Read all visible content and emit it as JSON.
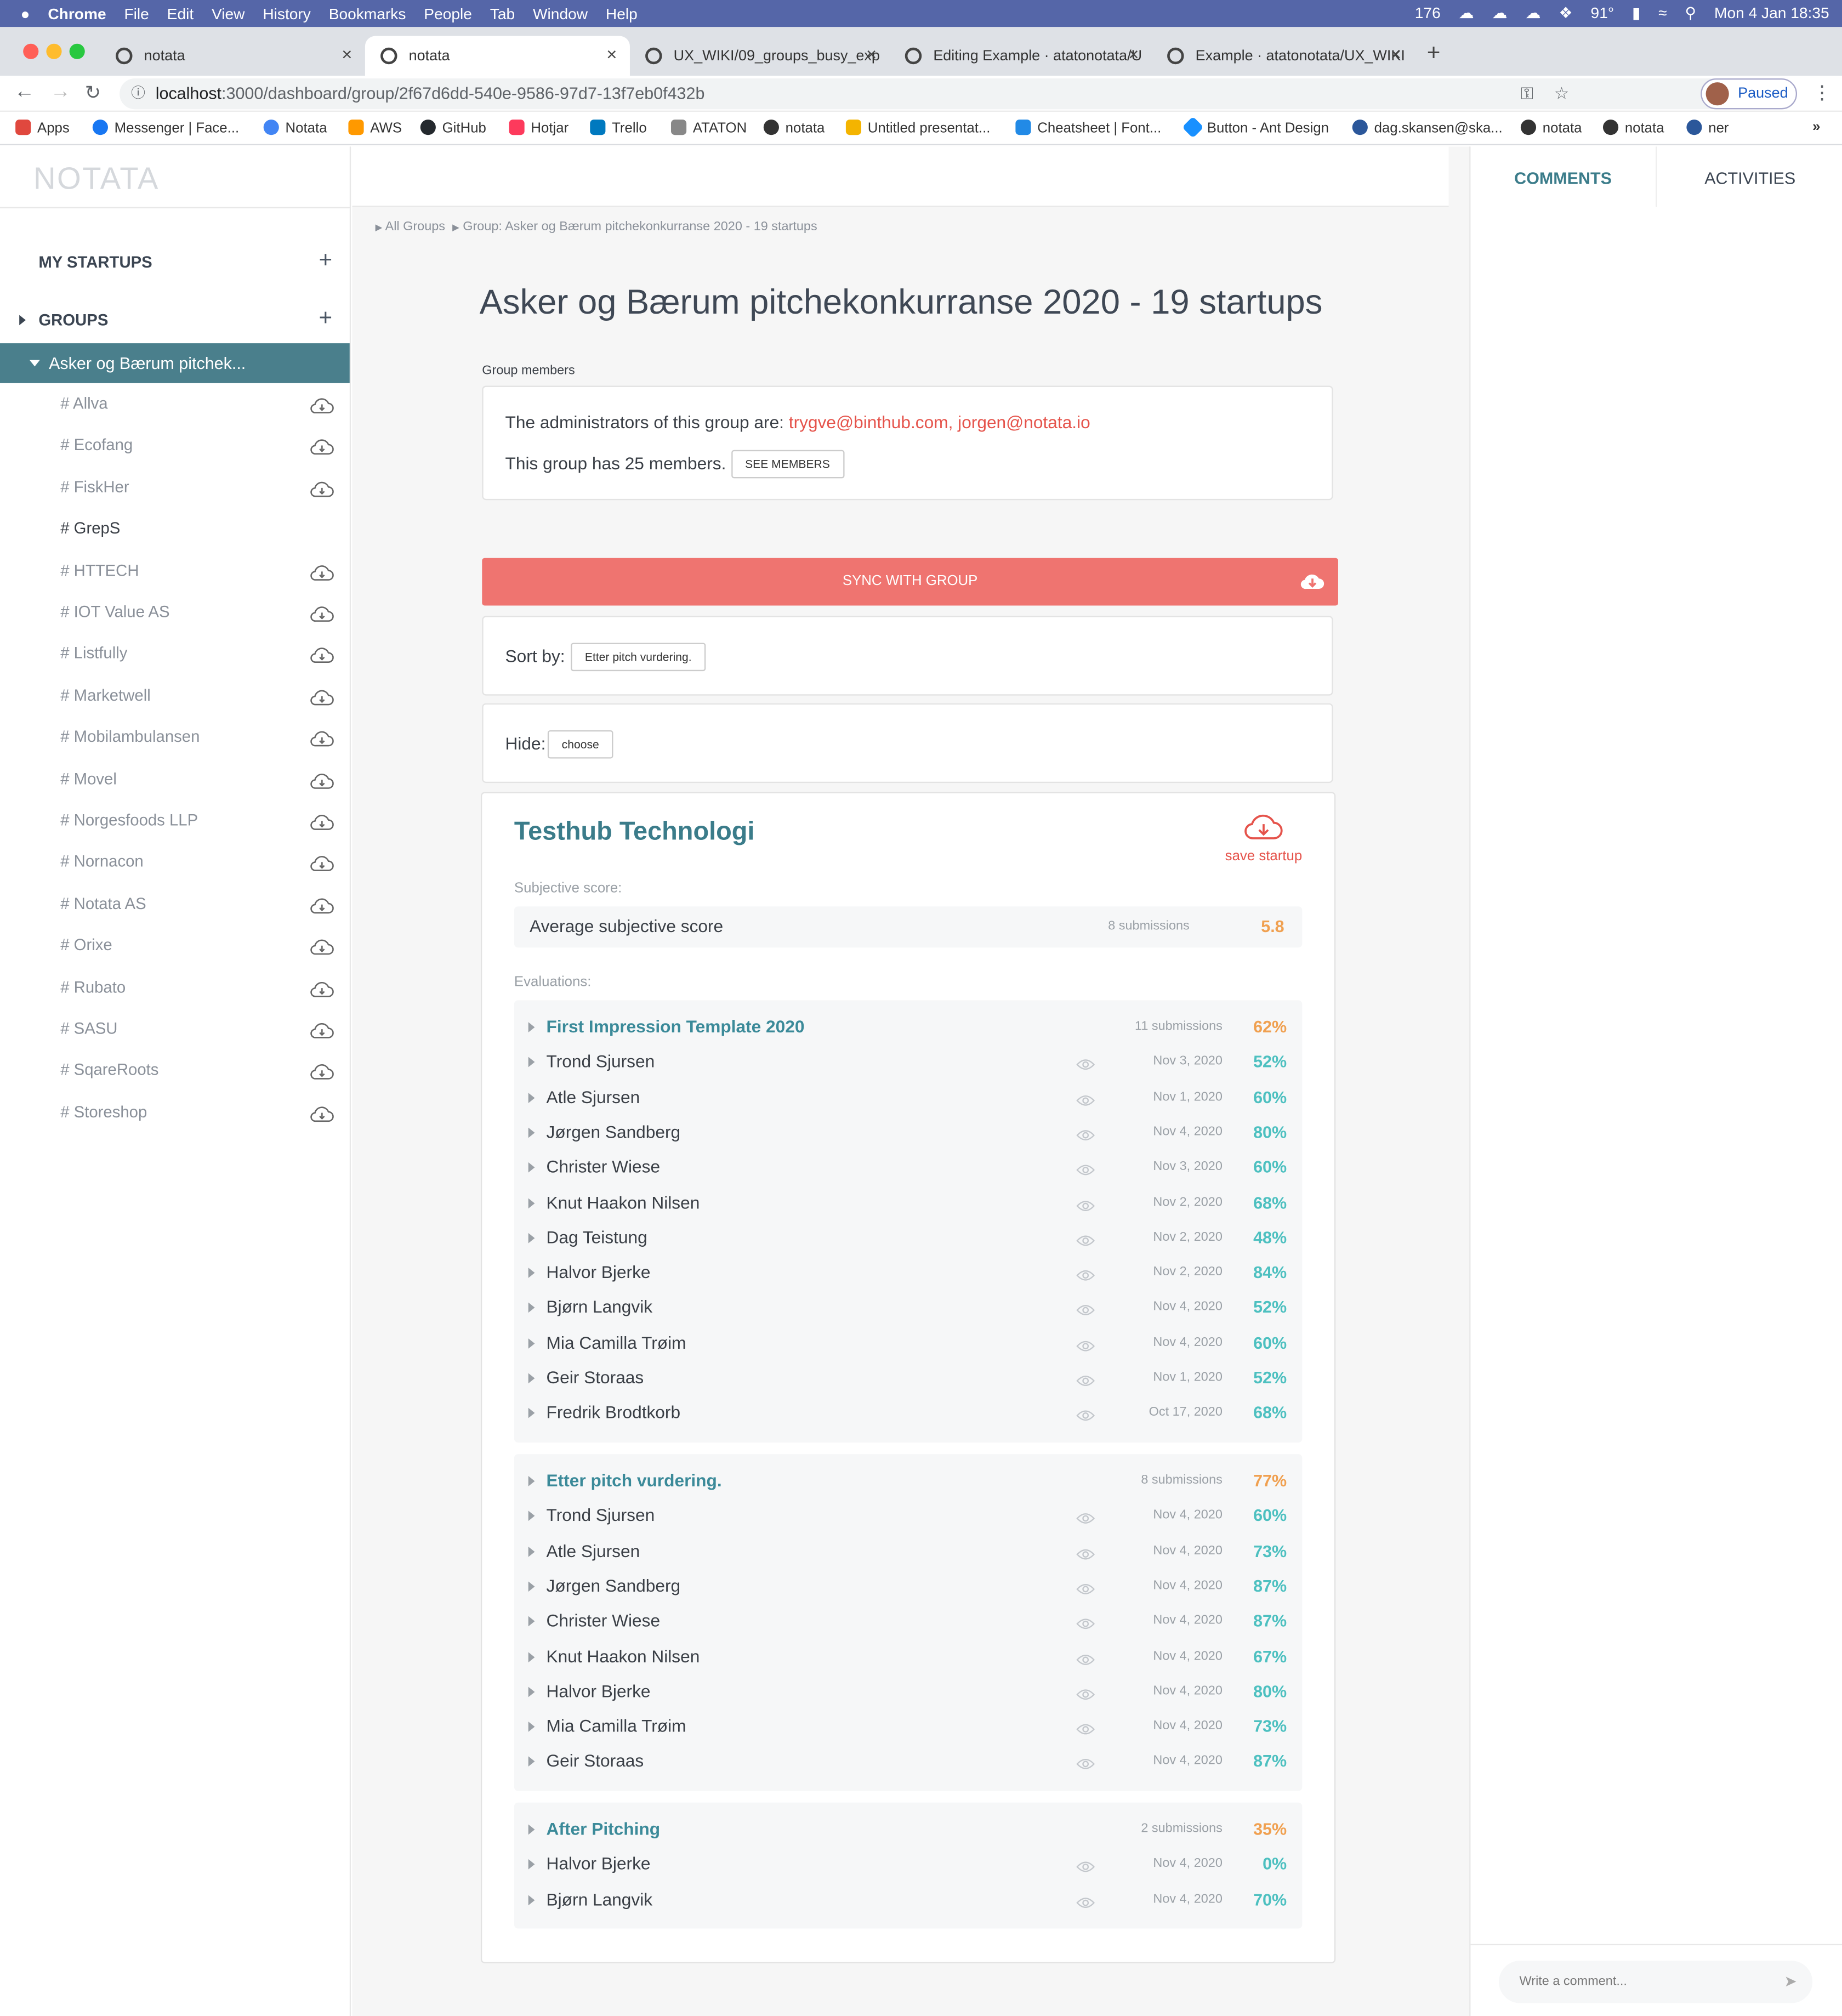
{
  "menubar": {
    "apple": "",
    "app": "Chrome",
    "items": [
      "File",
      "Edit",
      "View",
      "History",
      "Bookmarks",
      "People",
      "Tab",
      "Window",
      "Help"
    ],
    "status_num": "176",
    "battery_temp": "91°",
    "datetime": "Mon 4 Jan  18:35"
  },
  "tabs": [
    {
      "title": "notata"
    },
    {
      "title": "notata"
    },
    {
      "title": "UX_WIKI/09_groups_busy_exp"
    },
    {
      "title": "Editing Example · atatonotata/U"
    },
    {
      "title": "Example · atatonotata/UX_WIKI"
    }
  ],
  "address": {
    "host": "localhost",
    "path": ":3000/dashboard/group/2f67d6dd-540e-9586-97d7-13f7eb0f432b",
    "profile_status": "Paused"
  },
  "bookmarks": [
    {
      "label": "Apps",
      "color": "#e0483e"
    },
    {
      "label": "Messenger | Face...",
      "color": "#1877f2"
    },
    {
      "label": "Notata",
      "color": "#4285f4"
    },
    {
      "label": "AWS",
      "color": "#ff9900"
    },
    {
      "label": "GitHub",
      "color": "#24292e"
    },
    {
      "label": "Hotjar",
      "color": "#fd3a5c"
    },
    {
      "label": "Trello",
      "color": "#0079bf"
    },
    {
      "label": "ATATON",
      "color": "#888888"
    },
    {
      "label": "notata",
      "color": "#333333"
    },
    {
      "label": "Untitled presentat...",
      "color": "#f4b400"
    },
    {
      "label": "Cheatsheet | Font...",
      "color": "#228ae6"
    },
    {
      "label": "Button - Ant Design",
      "color": "#1890ff"
    },
    {
      "label": "dag.skansen@ska...",
      "color": "#2b579a"
    },
    {
      "label": "notata",
      "color": "#333333"
    },
    {
      "label": "notata",
      "color": "#333333"
    },
    {
      "label": "ner",
      "color": "#2b579a"
    }
  ],
  "sidebar": {
    "logo": "NOTATA",
    "my_startups": "MY STARTUPS",
    "groups": "GROUPS",
    "active_group": "Asker og Bærum pitchek...",
    "items": [
      {
        "label": "# Allva",
        "cloud": true
      },
      {
        "label": "# Ecofang",
        "cloud": true
      },
      {
        "label": "# FiskHer",
        "cloud": true
      },
      {
        "label": "# GrepS",
        "cloud": false
      },
      {
        "label": "# HTTECH",
        "cloud": true
      },
      {
        "label": "# IOT Value AS",
        "cloud": true
      },
      {
        "label": "# Listfully",
        "cloud": true
      },
      {
        "label": "# Marketwell",
        "cloud": true
      },
      {
        "label": "# Mobilambulansen",
        "cloud": true
      },
      {
        "label": "# Movel",
        "cloud": true
      },
      {
        "label": "# Norgesfoods LLP",
        "cloud": true
      },
      {
        "label": "# Nornacon",
        "cloud": true
      },
      {
        "label": "# Notata AS",
        "cloud": true
      },
      {
        "label": "# Orixe",
        "cloud": true
      },
      {
        "label": "# Rubato",
        "cloud": true
      },
      {
        "label": "# SASU",
        "cloud": true
      },
      {
        "label": "# SqareRoots",
        "cloud": true
      },
      {
        "label": "# Storeshop",
        "cloud": true
      }
    ]
  },
  "breadcrumb": {
    "root": "All Groups",
    "current": "Group: Asker og Bærum pitchekonkurranse 2020 - 19 startups"
  },
  "page_title": "Asker og Bærum pitchekonkurranse 2020 - 19 startups",
  "group_members": {
    "label": "Group members",
    "admins_prefix": "The administrators of this group are: ",
    "admins": "trygve@binthub.com, jorgen@notata.io",
    "members_text": "This group has 25 members.",
    "see_members": "SEE MEMBERS"
  },
  "sync": {
    "label": "SYNC WITH GROUP"
  },
  "sort": {
    "label": "Sort by:",
    "value": "Etter pitch vurdering."
  },
  "hide": {
    "label": "Hide:",
    "value": "choose"
  },
  "startup": {
    "name": "Testhub Technologi",
    "save_label": "save startup",
    "subjective_label": "Subjective score:",
    "avg_label": "Average subjective score",
    "avg_submissions": "8 submissions",
    "avg_score": "5.8",
    "evaluations_label": "Evaluations:",
    "evaluations": [
      {
        "name": "First Impression Template 2020",
        "submissions": "11 submissions",
        "score": "62%",
        "rows": [
          {
            "name": "Trond Sjursen",
            "date": "Nov 3, 2020",
            "score": "52%"
          },
          {
            "name": "Atle Sjursen",
            "date": "Nov 1, 2020",
            "score": "60%"
          },
          {
            "name": "Jørgen Sandberg",
            "date": "Nov 4, 2020",
            "score": "80%"
          },
          {
            "name": "Christer Wiese",
            "date": "Nov 3, 2020",
            "score": "60%"
          },
          {
            "name": "Knut Haakon Nilsen",
            "date": "Nov 2, 2020",
            "score": "68%"
          },
          {
            "name": "Dag Teistung",
            "date": "Nov 2, 2020",
            "score": "48%"
          },
          {
            "name": "Halvor Bjerke",
            "date": "Nov 2, 2020",
            "score": "84%"
          },
          {
            "name": "Bjørn Langvik",
            "date": "Nov 4, 2020",
            "score": "52%"
          },
          {
            "name": "Mia Camilla Trøim",
            "date": "Nov 4, 2020",
            "score": "60%"
          },
          {
            "name": "Geir Storaas",
            "date": "Nov 1, 2020",
            "score": "52%"
          },
          {
            "name": "Fredrik Brodtkorb",
            "date": "Oct 17, 2020",
            "score": "68%"
          }
        ]
      },
      {
        "name": "Etter pitch vurdering.",
        "submissions": "8 submissions",
        "score": "77%",
        "rows": [
          {
            "name": "Trond Sjursen",
            "date": "Nov 4, 2020",
            "score": "60%"
          },
          {
            "name": "Atle Sjursen",
            "date": "Nov 4, 2020",
            "score": "73%"
          },
          {
            "name": "Jørgen Sandberg",
            "date": "Nov 4, 2020",
            "score": "87%"
          },
          {
            "name": "Christer Wiese",
            "date": "Nov 4, 2020",
            "score": "87%"
          },
          {
            "name": "Knut Haakon Nilsen",
            "date": "Nov 4, 2020",
            "score": "67%"
          },
          {
            "name": "Halvor Bjerke",
            "date": "Nov 4, 2020",
            "score": "80%"
          },
          {
            "name": "Mia Camilla Trøim",
            "date": "Nov 4, 2020",
            "score": "73%"
          },
          {
            "name": "Geir Storaas",
            "date": "Nov 4, 2020",
            "score": "87%"
          }
        ]
      },
      {
        "name": "After Pitching",
        "submissions": "2 submissions",
        "score": "35%",
        "rows": [
          {
            "name": "Halvor Bjerke",
            "date": "Nov 4, 2020",
            "score": "0%"
          },
          {
            "name": "Bjørn Langvik",
            "date": "Nov 4, 2020",
            "score": "70%"
          }
        ]
      }
    ]
  },
  "right_panel": {
    "comments_tab": "COMMENTS",
    "activities_tab": "ACTIVITIES",
    "comment_placeholder": "Write a comment..."
  },
  "colors": {
    "accent": "#4a7f8c",
    "sync": "#ef7470",
    "score_teal": "#4dc0c0",
    "score_orange": "#f0a050",
    "link_red": "#e5534b"
  }
}
